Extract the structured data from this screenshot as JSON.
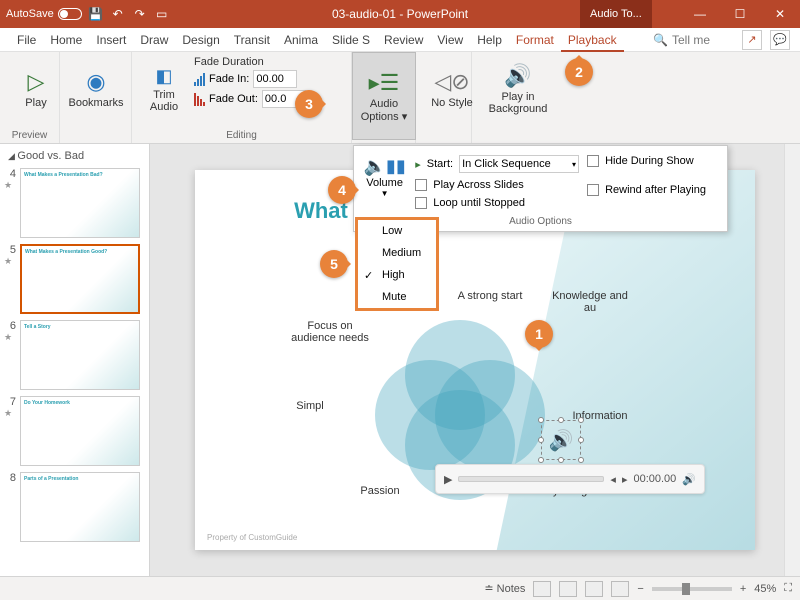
{
  "titlebar": {
    "autosave": "AutoSave",
    "doc": "03-audio-01 - PowerPoint",
    "contextual": "Audio To..."
  },
  "tabs": {
    "file": "File",
    "home": "Home",
    "insert": "Insert",
    "draw": "Draw",
    "design": "Design",
    "transitions": "Transit",
    "animations": "Anima",
    "slideshow": "Slide S",
    "review": "Review",
    "view": "View",
    "help": "Help",
    "format": "Format",
    "playback": "Playback",
    "tellme": "Tell me"
  },
  "ribbon": {
    "preview": {
      "play": "Play",
      "label": "Preview"
    },
    "bookmarks": {
      "btn": "Bookmarks"
    },
    "editing": {
      "trim": "Trim Audio",
      "fade_title": "Fade Duration",
      "fade_in": "Fade In:",
      "fade_out": "Fade Out:",
      "fade_in_val": "00.00",
      "fade_out_val": "00.0",
      "label": "Editing"
    },
    "audio_opts_btn": "Audio Options",
    "no_style": "No Style",
    "play_bg": "Play in Background"
  },
  "audio_popup": {
    "volume": "Volume",
    "start_label": "Start:",
    "start_value": "In Click Sequence",
    "play_across": "Play Across Slides",
    "loop": "Loop until Stopped",
    "hide": "Hide During Show",
    "rewind": "Rewind after Playing",
    "footer": "Audio Options"
  },
  "volume_menu": {
    "low": "Low",
    "medium": "Medium",
    "high": "High",
    "mute": "Mute"
  },
  "outline": {
    "title": "Good vs. Bad",
    "items": [
      {
        "n": "4",
        "title": "What Makes a Presentation Bad?"
      },
      {
        "n": "5",
        "title": "What Makes a Presentation Good?"
      },
      {
        "n": "6",
        "title": "Tell a Story"
      },
      {
        "n": "7",
        "title": "Do Your Homework"
      },
      {
        "n": "8",
        "title": "Parts of a Presentation"
      }
    ]
  },
  "slide": {
    "title": "What Makes a Presentation Good?",
    "pts": {
      "strong": "A strong start",
      "knowledge": "Knowledge and au",
      "focus": "Focus on audience needs",
      "simple": "Simpl",
      "info": "Information",
      "passion": "Passion",
      "story": "Storytelling"
    },
    "footer": "Property of CustomGuide"
  },
  "player": {
    "time": "00:00.00"
  },
  "callouts": {
    "c1": "1",
    "c2": "2",
    "c3": "3",
    "c4": "4",
    "c5": "5"
  },
  "status": {
    "notes": "Notes",
    "zoom": "45%"
  }
}
